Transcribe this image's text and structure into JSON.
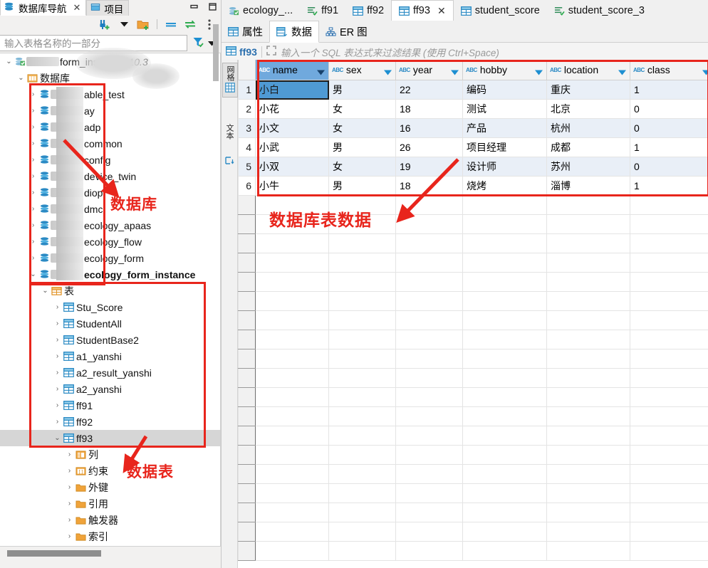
{
  "left_panel": {
    "tabs": [
      {
        "label": "数据库导航",
        "icon": "database-nav-icon",
        "active": true,
        "closable": true
      },
      {
        "label": "项目",
        "icon": "project-icon",
        "active": false,
        "closable": false
      }
    ],
    "window_controls": [
      {
        "name": "minimize-button",
        "label": "—"
      },
      {
        "name": "maximize-button",
        "label": "▭"
      }
    ],
    "toolbar_buttons": [
      {
        "name": "new-connection-button",
        "label": "new-connection-icon"
      },
      {
        "name": "connection-dropdown-button",
        "label": "chevron-down-icon"
      },
      {
        "name": "new-folder-button",
        "label": "new-folder-icon"
      },
      {
        "name": "collapse-all-button",
        "label": "collapse-all-icon"
      },
      {
        "name": "link-editor-button",
        "label": "link-editor-icon"
      },
      {
        "name": "view-menu-button",
        "label": "kebab-menu-icon"
      }
    ],
    "filter": {
      "placeholder": "输入表格名称的一部分",
      "value": "",
      "filter_icon": "funnel-icon",
      "dropdown_icon": "chevron-down-icon"
    },
    "tree": [
      {
        "label": "form_instance",
        "suffix": " - 10.3",
        "icon": "connection-icon",
        "indent": 0,
        "expanded": true,
        "blurred_prefix": true,
        "bold": false
      },
      {
        "label": "数据库",
        "icon": "databases-folder-icon",
        "indent": 1,
        "expanded": true,
        "blurred_prefix": false,
        "bold": false
      },
      {
        "label": "able_test",
        "icon": "database-icon",
        "indent": 2,
        "expanded": false,
        "blurred_prefix": true,
        "bold": false
      },
      {
        "label": "ay",
        "icon": "database-icon",
        "indent": 2,
        "expanded": false,
        "blurred_prefix": true,
        "bold": false
      },
      {
        "label": "adp",
        "icon": "database-icon",
        "indent": 2,
        "expanded": false,
        "blurred_prefix": true,
        "bold": false
      },
      {
        "label": "common",
        "icon": "database-icon",
        "indent": 2,
        "expanded": false,
        "blurred_prefix": true,
        "bold": false
      },
      {
        "label": "config",
        "icon": "database-icon",
        "indent": 2,
        "expanded": false,
        "blurred_prefix": true,
        "bold": false
      },
      {
        "label": "device_twin",
        "icon": "database-icon",
        "indent": 2,
        "expanded": false,
        "blurred_prefix": true,
        "bold": false
      },
      {
        "label": "diop",
        "icon": "database-icon",
        "indent": 2,
        "expanded": false,
        "blurred_prefix": true,
        "bold": false
      },
      {
        "label": "dmc",
        "icon": "database-icon",
        "indent": 2,
        "expanded": false,
        "blurred_prefix": true,
        "bold": false
      },
      {
        "label": "ecology_apaas",
        "icon": "database-icon",
        "indent": 2,
        "expanded": false,
        "blurred_prefix": true,
        "bold": false
      },
      {
        "label": "ecology_flow",
        "icon": "database-icon",
        "indent": 2,
        "expanded": false,
        "blurred_prefix": true,
        "bold": false
      },
      {
        "label": "ecology_form",
        "icon": "database-icon",
        "indent": 2,
        "expanded": false,
        "blurred_prefix": true,
        "bold": false
      },
      {
        "label": "ecology_form_instance",
        "icon": "database-icon",
        "indent": 2,
        "expanded": true,
        "blurred_prefix": true,
        "bold": true
      },
      {
        "label": "表",
        "icon": "tables-folder-icon",
        "indent": 3,
        "expanded": true,
        "blurred_prefix": false,
        "bold": false
      },
      {
        "label": "Stu_Score",
        "icon": "table-icon",
        "indent": 4,
        "expanded": false,
        "blurred_prefix": false,
        "bold": false
      },
      {
        "label": "StudentAll",
        "icon": "table-icon",
        "indent": 4,
        "expanded": false,
        "blurred_prefix": false,
        "bold": false
      },
      {
        "label": "StudentBase2",
        "icon": "table-icon",
        "indent": 4,
        "expanded": false,
        "blurred_prefix": false,
        "bold": false
      },
      {
        "label": "a1_yanshi",
        "icon": "table-icon",
        "indent": 4,
        "expanded": false,
        "blurred_prefix": false,
        "bold": false
      },
      {
        "label": "a2_result_yanshi",
        "icon": "table-icon",
        "indent": 4,
        "expanded": false,
        "blurred_prefix": false,
        "bold": false
      },
      {
        "label": "a2_yanshi",
        "icon": "table-icon",
        "indent": 4,
        "expanded": false,
        "blurred_prefix": false,
        "bold": false
      },
      {
        "label": "ff91",
        "icon": "table-icon",
        "indent": 4,
        "expanded": false,
        "blurred_prefix": false,
        "bold": false
      },
      {
        "label": "ff92",
        "icon": "table-icon",
        "indent": 4,
        "expanded": false,
        "blurred_prefix": false,
        "bold": false
      },
      {
        "label": "ff93",
        "icon": "table-icon",
        "indent": 4,
        "expanded": true,
        "selected": true,
        "blurred_prefix": false,
        "bold": false
      },
      {
        "label": "列",
        "icon": "columns-folder-icon",
        "indent": 5,
        "expanded": false,
        "blurred_prefix": false,
        "bold": false
      },
      {
        "label": "约束",
        "icon": "constraints-folder-icon",
        "indent": 5,
        "expanded": false,
        "blurred_prefix": false,
        "bold": false
      },
      {
        "label": "外键",
        "icon": "folder-icon",
        "indent": 5,
        "expanded": false,
        "blurred_prefix": false,
        "bold": false
      },
      {
        "label": "引用",
        "icon": "folder-icon",
        "indent": 5,
        "expanded": false,
        "blurred_prefix": false,
        "bold": false
      },
      {
        "label": "触发器",
        "icon": "folder-icon",
        "indent": 5,
        "expanded": false,
        "blurred_prefix": false,
        "bold": false
      },
      {
        "label": "索引",
        "icon": "folder-icon",
        "indent": 5,
        "expanded": false,
        "blurred_prefix": false,
        "bold": false
      }
    ]
  },
  "editor": {
    "tabs": [
      {
        "label": "ecology_...",
        "icon": "connection-icon",
        "active": false,
        "closable": false
      },
      {
        "label": "ff91",
        "icon": "sql-editor-icon",
        "active": false,
        "closable": false
      },
      {
        "label": "ff92",
        "icon": "table-icon",
        "active": false,
        "closable": false
      },
      {
        "label": "ff93",
        "icon": "table-icon",
        "active": true,
        "closable": true
      },
      {
        "label": "student_score",
        "icon": "table-icon",
        "active": false,
        "closable": false
      },
      {
        "label": "student_score_3",
        "icon": "sql-editor-icon",
        "active": false,
        "closable": false
      }
    ],
    "close_label": "✕",
    "sub_tabs": [
      {
        "label": "属性",
        "icon": "properties-icon",
        "active": false
      },
      {
        "label": "数据",
        "icon": "data-icon",
        "active": true
      },
      {
        "label": "ER 图",
        "icon": "er-diagram-icon",
        "active": false
      }
    ],
    "filter_row": {
      "table_name": "ff93",
      "table_icon": "table-icon",
      "expand_icon": "expand-icon",
      "placeholder": "输入一个 SQL 表达式来过滤结果 (使用 Ctrl+Space)"
    },
    "side_strip": {
      "grid_label": "网格",
      "grid_icon": "grid-icon",
      "text_label": "文本",
      "text_icon": "text-icon",
      "calc_icon": "calc-icon"
    }
  },
  "chart_data": {
    "type": "table",
    "title": "ff93",
    "columns": [
      {
        "name": "name",
        "type": "ABC"
      },
      {
        "name": "sex",
        "type": "ABC"
      },
      {
        "name": "year",
        "type": "ABC"
      },
      {
        "name": "hobby",
        "type": "ABC"
      },
      {
        "name": "location",
        "type": "ABC"
      },
      {
        "name": "class",
        "type": "ABC"
      }
    ],
    "selected_column": "name",
    "selected_cell": {
      "row": 1,
      "column": "name",
      "value": "小白"
    },
    "rows": [
      {
        "no": "1",
        "name": "小白",
        "sex": "男",
        "year": "22",
        "hobby": "编码",
        "location": "重庆",
        "class": "1"
      },
      {
        "no": "2",
        "name": "小花",
        "sex": "女",
        "year": "18",
        "hobby": "测试",
        "location": "北京",
        "class": "0"
      },
      {
        "no": "3",
        "name": "小文",
        "sex": "女",
        "year": "16",
        "hobby": "产品",
        "location": "杭州",
        "class": "0"
      },
      {
        "no": "4",
        "name": "小武",
        "sex": "男",
        "year": "26",
        "hobby": "项目经理",
        "location": "成都",
        "class": "1"
      },
      {
        "no": "5",
        "name": "小双",
        "sex": "女",
        "year": "19",
        "hobby": "设计师",
        "location": "苏州",
        "class": "0"
      },
      {
        "no": "6",
        "name": "小牛",
        "sex": "男",
        "year": "18",
        "hobby": "烧烤",
        "location": "淄博",
        "class": "1"
      }
    ],
    "empty_row_count": 19
  },
  "annotations": [
    {
      "id": "ann-databases",
      "text": "数据库",
      "color": "#e8251c"
    },
    {
      "id": "ann-tables",
      "text": "数据表",
      "color": "#e8251c"
    },
    {
      "id": "ann-tabledata",
      "text": "数据库表数据",
      "color": "#e8251c"
    }
  ],
  "colors": {
    "annotation_red": "#e8251c",
    "selection_blue": "#70a9dd",
    "alt_row": "#e9eff7",
    "tab_active": "#ffffff"
  }
}
